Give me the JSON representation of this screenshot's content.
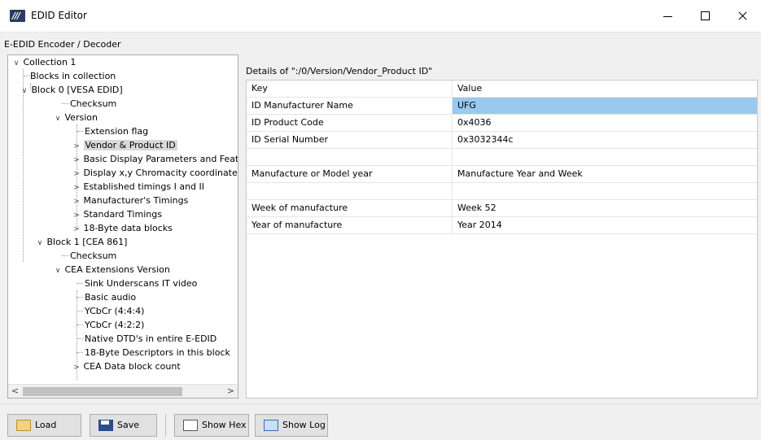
{
  "window": {
    "title": "EDID Editor",
    "minimize_icon": "minimize-icon",
    "maximize_icon": "maximize-icon",
    "close_icon": "close-icon"
  },
  "group_label": "E-EDID Encoder / Decoder",
  "tree": {
    "nodes": [
      {
        "label": "Collection 1",
        "expander": "∨"
      },
      {
        "label": "Blocks in collection",
        "expander": ""
      },
      {
        "label": "Block 0 [VESA EDID]",
        "expander": "∨"
      },
      {
        "label": "Checksum",
        "expander": ""
      },
      {
        "label": "Version",
        "expander": "∨"
      },
      {
        "label": "Extension flag",
        "expander": ""
      },
      {
        "label": "Vendor & Product ID",
        "expander": ">"
      },
      {
        "label": "Basic Display Parameters and Featu",
        "expander": ">"
      },
      {
        "label": "Display x,y Chromacity coordinates",
        "expander": ">"
      },
      {
        "label": "Established timings I and II",
        "expander": ">"
      },
      {
        "label": "Manufacturer's Timings",
        "expander": ">"
      },
      {
        "label": "Standard Timings",
        "expander": ">"
      },
      {
        "label": "18-Byte data blocks",
        "expander": ">"
      },
      {
        "label": "Block 1 [CEA 861]",
        "expander": "∨"
      },
      {
        "label": "Checksum",
        "expander": ""
      },
      {
        "label": "CEA Extensions Version",
        "expander": "∨"
      },
      {
        "label": "Sink Underscans IT video",
        "expander": ""
      },
      {
        "label": "Basic audio",
        "expander": ""
      },
      {
        "label": "YCbCr (4:4:4)",
        "expander": ""
      },
      {
        "label": "YCbCr (4:2:2)",
        "expander": ""
      },
      {
        "label": "Native DTD's in entire E-EDID",
        "expander": ""
      },
      {
        "label": "18-Byte Descriptors in this block",
        "expander": ""
      },
      {
        "label": "CEA Data block count",
        "expander": ">"
      }
    ],
    "selected": "Vendor & Product ID",
    "scroll_left": "<",
    "scroll_right": ">"
  },
  "details": {
    "title": "Details of \":/0/Version/Vendor_Product ID\"",
    "headers": {
      "key": "Key",
      "value": "Value"
    },
    "rows": [
      {
        "key": "ID Manufacturer Name",
        "value": "UFG"
      },
      {
        "key": "ID Product Code",
        "value": "0x4036"
      },
      {
        "key": "ID Serial Number",
        "value": "0x3032344c"
      },
      {
        "key": "",
        "value": ""
      },
      {
        "key": "Manufacture or Model year",
        "value": "Manufacture Year and Week"
      },
      {
        "key": "",
        "value": ""
      },
      {
        "key": "Week of manufacture",
        "value": "Week 52"
      },
      {
        "key": "Year of manufacture",
        "value": "Year 2014"
      }
    ],
    "selected_value": "UFG"
  },
  "toolbar": {
    "load_label": "Load",
    "save_label": "Save",
    "show_hex_label": "Show Hex",
    "show_log_label": "Show Log"
  }
}
